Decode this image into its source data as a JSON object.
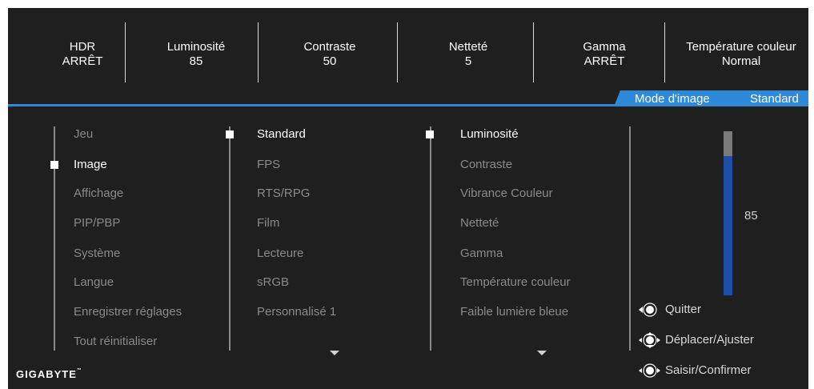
{
  "status_bar": [
    {
      "label": "HDR",
      "value": "ARRÊT"
    },
    {
      "label": "Luminosité",
      "value": "85"
    },
    {
      "label": "Contraste",
      "value": "50"
    },
    {
      "label": "Netteté",
      "value": "5"
    },
    {
      "label": "Gamma",
      "value": "ARRÊT"
    },
    {
      "label": "Température couleur",
      "value": "Normal"
    }
  ],
  "mode_tab": {
    "label": "Mode d'image",
    "value": "Standard"
  },
  "main_menu": [
    "Jeu",
    "Image",
    "Affichage",
    "PIP/PBP",
    "Système",
    "Langue",
    "Enregistrer réglages",
    "Tout réinitialiser"
  ],
  "main_menu_selected": 1,
  "picture_modes": [
    "Standard",
    "FPS",
    "RTS/RPG",
    "Film",
    "Lecteure",
    "sRGB",
    "Personnalisé 1"
  ],
  "picture_modes_selected": 0,
  "settings": [
    "Luminosité",
    "Contraste",
    "Vibrance Couleur",
    "Netteté",
    "Gamma",
    "Température couleur",
    "Faible lumière bleue"
  ],
  "settings_selected": 0,
  "slider": {
    "value": "85",
    "level_percent": 85
  },
  "hints": [
    {
      "icon": "joystick-left-icon",
      "label": "Quitter"
    },
    {
      "icon": "joystick-updown-icon",
      "label": "Déplacer/Ajuster"
    },
    {
      "icon": "joystick-press-icon",
      "label": "Saisir/Confirmer"
    }
  ],
  "brand": "GIGABYTE",
  "colors": {
    "accent": "#2e8ad8",
    "slider_fill": "#1f4ea8",
    "background": "#1f1f1f"
  }
}
